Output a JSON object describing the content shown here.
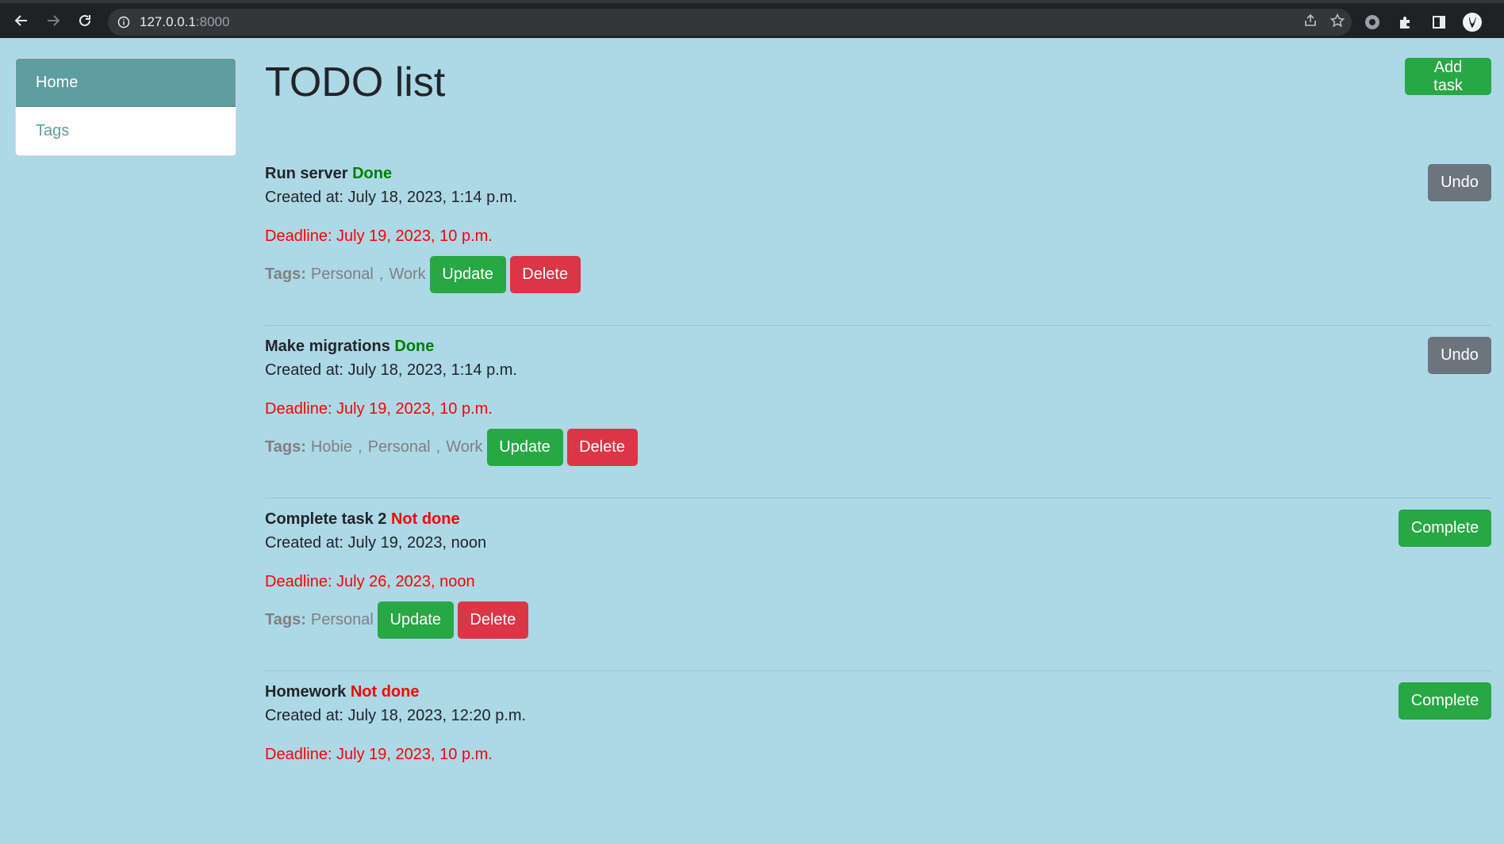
{
  "browser": {
    "url_host": "127.0.0.1",
    "url_port": ":8000"
  },
  "sidebar": {
    "items": [
      {
        "label": "Home",
        "active": true
      },
      {
        "label": "Tags",
        "active": false
      }
    ]
  },
  "main": {
    "title": "TODO list",
    "add_task_label": "Add task",
    "tags_label": "Tags:",
    "update_label": "Update",
    "delete_label": "Delete",
    "tasks": [
      {
        "name": "Run server",
        "status": "Done",
        "created": "Created at: July 18, 2023, 1:14 p.m.",
        "deadline": "Deadline: July 19, 2023, 10 p.m.",
        "tags": [
          "Personal",
          "Work"
        ],
        "action_label": "Undo"
      },
      {
        "name": "Make migrations",
        "status": "Done",
        "created": "Created at: July 18, 2023, 1:14 p.m.",
        "deadline": "Deadline: July 19, 2023, 10 p.m.",
        "tags": [
          "Hobie",
          "Personal",
          "Work"
        ],
        "action_label": "Undo"
      },
      {
        "name": "Complete task 2",
        "status": "Not done",
        "created": "Created at: July 19, 2023, noon",
        "deadline": "Deadline: July 26, 2023, noon",
        "tags": [
          "Personal"
        ],
        "action_label": "Complete"
      },
      {
        "name": "Homework",
        "status": "Not done",
        "created": "Created at: July 18, 2023, 12:20 p.m.",
        "deadline": "Deadline: July 19, 2023, 10 p.m.",
        "tags": [],
        "action_label": "Complete"
      }
    ]
  },
  "colors": {
    "page_bg": "#add8e6",
    "sidebar_active": "#5f9ea0",
    "success": "#28a745",
    "danger": "#dc3545",
    "secondary": "#6c757d",
    "done": "#008000",
    "not_done": "#ff0000"
  }
}
